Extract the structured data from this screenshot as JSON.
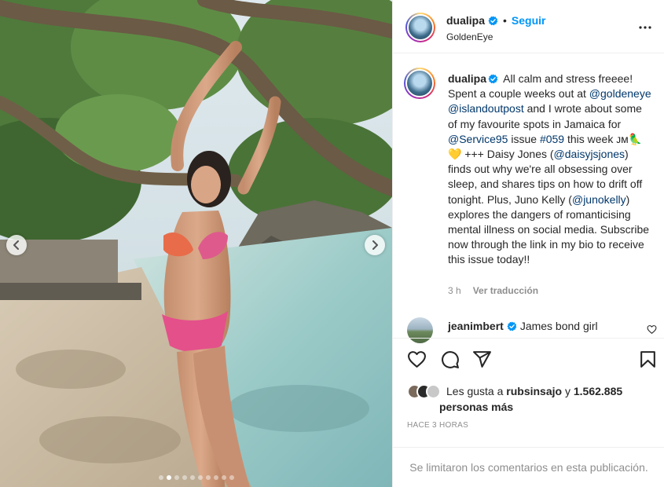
{
  "post": {
    "username": "dualipa",
    "separator": "•",
    "follow_label": "Seguir",
    "location": "GoldenEye",
    "more_icon": "more-horizontal-icon",
    "accent_color": "#0095f6"
  },
  "caption": {
    "username": "dualipa",
    "parts": {
      "p1": " All calm and stress freeee! Spent a couple weeks out at ",
      "m1": "@goldeneye",
      "p2": " ",
      "m2": "@islandoutpost",
      "p3": " and I wrote about some of my favourite spots in Jamaica for ",
      "m3": "@Service95",
      "p4": " issue ",
      "h1": "#059",
      "p5": " this week ᴊᴍ🦜💛 +++ Daisy Jones (",
      "m4": "@daisyjsjones",
      "p6": ") finds out why we're all obsessing over sleep, and shares tips on how to drift off tonight. Plus, Juno Kelly (",
      "m5": "@junokelly",
      "p7": ") explores the dangers of romanticising mental illness on social media. Subscribe now through the link in my bio to receive this issue today!!"
    },
    "age": "3 h",
    "translate_label": "Ver traducción"
  },
  "comment": {
    "username": "jeanimbert",
    "text": "James bond girl"
  },
  "likes": {
    "prefix": "Les gusta a",
    "user": "rubsinsajo",
    "middle": "y",
    "count": "1.562.885",
    "suffix": "personas más"
  },
  "timestamp": "HACE 3 HORAS",
  "footer": "Se limitaron los comentarios en esta publicación.",
  "carousel": {
    "total": 10,
    "active": 2
  }
}
